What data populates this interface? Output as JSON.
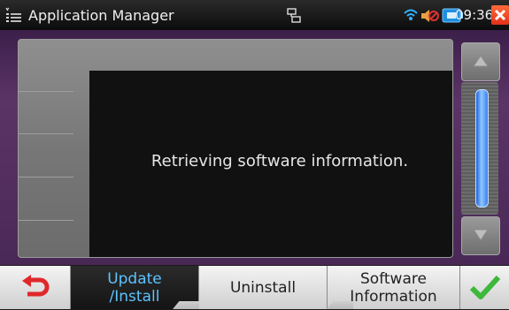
{
  "titlebar": {
    "title": "Application Manager",
    "time": "09:36",
    "icons": [
      "app-menu-icon",
      "network-icon",
      "wifi-icon",
      "volume-muted-icon",
      "battery-icon",
      "close-icon"
    ]
  },
  "dialog": {
    "message": "Retrieving software information."
  },
  "scrollbar": {
    "thumb_start_fraction": 0.05,
    "thumb_end_fraction": 0.93
  },
  "bottombar": {
    "update_label_1": "Update",
    "update_label_2": "/Install",
    "uninstall_label": "Uninstall",
    "swinfo_label_1": "Software",
    "swinfo_label_2": "Information"
  },
  "colors": {
    "accent": "#5ec3ff",
    "background": "#4a2856",
    "confirm": "#3db83a",
    "back": "#e0282a"
  }
}
